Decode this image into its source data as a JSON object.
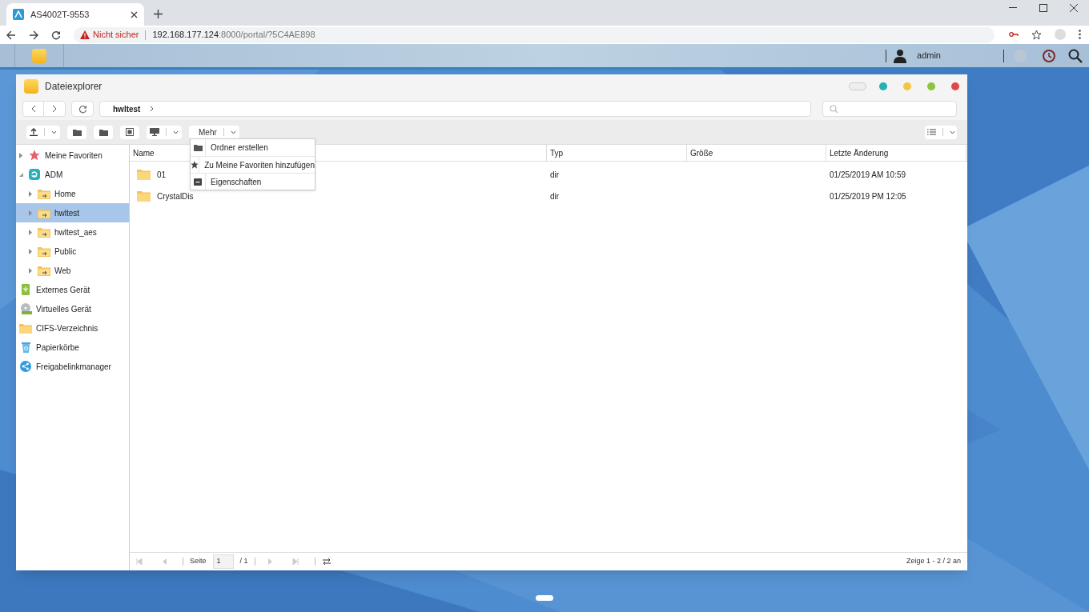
{
  "browser": {
    "tab_title": "AS4002T-9553",
    "address": {
      "warning": "Nicht sicher",
      "host": "192.168.177.124",
      "path": ":8000/portal/?5C4AE898"
    }
  },
  "portal": {
    "user": "admin"
  },
  "window": {
    "title": "Dateiexplorer",
    "breadcrumb": "hwltest",
    "more_button": "Mehr",
    "menu": [
      {
        "kind": "new-folder",
        "label": "Ordner erstellen"
      },
      {
        "kind": "favorite",
        "label": "Zu Meine Favoriten hinzufügen"
      },
      {
        "kind": "properties",
        "label": "Eigenschaften"
      }
    ],
    "sidebar": [
      {
        "kind": "favorites",
        "label": "Meine Favoriten",
        "expanded": false,
        "selected": false
      },
      {
        "kind": "adm",
        "label": "ADM",
        "expanded": true,
        "selected": false,
        "children": [
          {
            "kind": "share",
            "label": "Home",
            "expanded": false,
            "selected": false
          },
          {
            "kind": "share",
            "label": "hwltest",
            "expanded": false,
            "selected": true
          },
          {
            "kind": "share",
            "label": "hwltest_aes",
            "expanded": false,
            "selected": false
          },
          {
            "kind": "share",
            "label": "Public",
            "expanded": false,
            "selected": false
          },
          {
            "kind": "share",
            "label": "Web",
            "expanded": false,
            "selected": false
          }
        ]
      },
      {
        "kind": "external",
        "label": "Externes Gerät",
        "selected": false
      },
      {
        "kind": "virtual",
        "label": "Virtuelles Gerät",
        "selected": false
      },
      {
        "kind": "cifs",
        "label": "CIFS-Verzeichnis",
        "selected": false
      },
      {
        "kind": "trash",
        "label": "Papierkörbe",
        "selected": false
      },
      {
        "kind": "link",
        "label": "Freigabelinkmanager",
        "selected": false
      }
    ],
    "table": {
      "columns": [
        "Name",
        "Typ",
        "Größe",
        "Letzte Änderung"
      ],
      "rows": [
        {
          "name": "01",
          "type": "dir",
          "modified": "01/25/2019 AM 10:59"
        },
        {
          "name": "CrystalDis",
          "type": "dir",
          "modified": "01/25/2019 PM 12:05"
        }
      ]
    },
    "footer": {
      "page_label": "Seite",
      "page_value": "1",
      "page_total": "/ 1",
      "summary": "Zeige 1 - 2 / 2 an"
    }
  }
}
